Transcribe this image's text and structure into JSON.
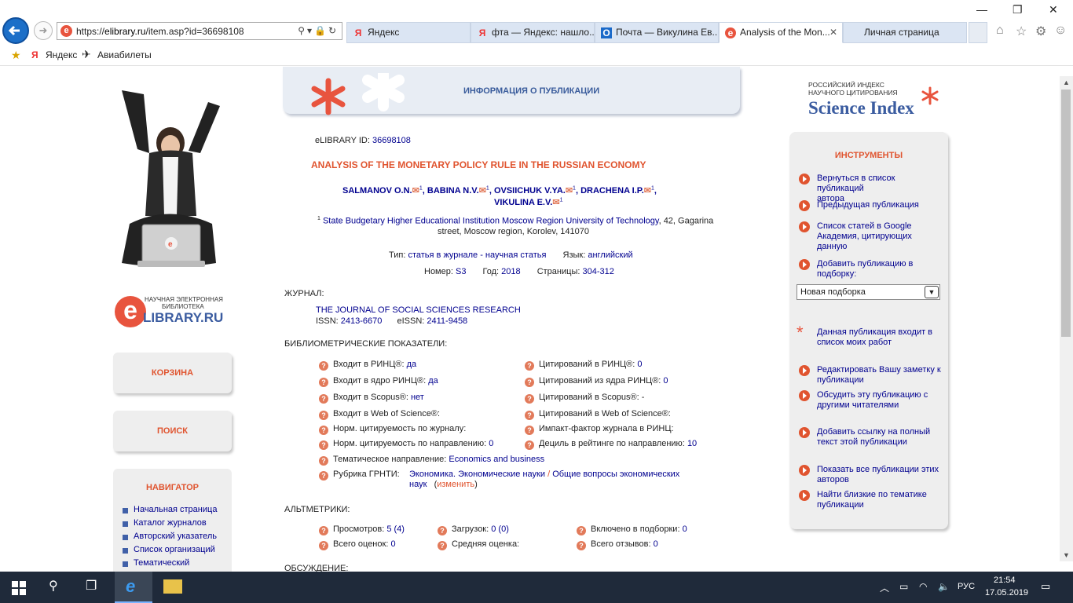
{
  "browser": {
    "url_prefix": "https://",
    "url_host": "elibrary.ru",
    "url_path": "/item.asp?id=36698108",
    "tabs": [
      {
        "icon": "Я",
        "label": "Яндекс"
      },
      {
        "icon": "Я",
        "label": "фта — Яндекс: нашло..."
      },
      {
        "icon": "О",
        "label": "Почта — Викулина Ев..."
      },
      {
        "icon": "e",
        "label": "Analysis of the Mon..."
      },
      {
        "icon": "",
        "label": "Личная страница"
      }
    ],
    "favorites": [
      {
        "label": "Яндекс"
      },
      {
        "label": "Авиабилеты"
      }
    ]
  },
  "left": {
    "logo_line1": "НАУЧНАЯ ЭЛЕКТРОННАЯ",
    "logo_line2": "БИБЛИОТЕКА",
    "logo_main": "LIBRARY.RU",
    "logo_e": "e",
    "cart": "КОРЗИНА",
    "search": "ПОИСК",
    "navigator": "НАВИГАТОР",
    "nav_items": [
      "Начальная страница",
      "Каталог журналов",
      "Авторский указатель",
      "Список организаций",
      "Тематический"
    ]
  },
  "header": {
    "title": "ИНФОРМАЦИЯ О ПУБЛИКАЦИИ"
  },
  "pub": {
    "id_label": "eLIBRARY ID:",
    "id": "36698108",
    "title": "ANALYSIS OF THE MONETARY POLICY RULE IN THE RUSSIAN ECONOMY",
    "authors_line1": [
      "SALMANOV O.N.",
      "BABINA N.V.",
      "OVSIICHUK V.YA.",
      "DRACHENA I.P."
    ],
    "authors_line2": "VIKULINA E.V.",
    "aff_num": "1",
    "affiliation_link": "State Budgetary Higher Educational Institution Moscow Region University of Technology",
    "affiliation_rest1": ", 42, Gagarina",
    "affiliation_rest2": "street, Moscow region, Korolev, 141070",
    "type_label": "Тип:",
    "type_value": "статья в журнале - научная статья",
    "lang_label": "Язык:",
    "lang_value": "английский",
    "num_label": "Номер:",
    "num_value": "S3",
    "year_label": "Год:",
    "year_value": "2018",
    "pages_label": "Страницы:",
    "pages_value": "304-312"
  },
  "journal": {
    "section": "ЖУРНАЛ:",
    "name": "THE JOURNAL OF SOCIAL SCIENCES RESEARCH",
    "issn_label": "ISSN:",
    "issn": "2413-6670",
    "eissn_label": "eISSN:",
    "eissn": "2411-9458"
  },
  "biblio": {
    "section": "БИБЛИОМЕТРИЧЕСКИЕ ПОКАЗАТЕЛИ:",
    "left": [
      {
        "label": "Входит в РИНЦ®:",
        "value": "да"
      },
      {
        "label": "Входит в ядро РИНЦ®:",
        "value": "да"
      },
      {
        "label": "Входит в Scopus®:",
        "value": "нет"
      },
      {
        "label": "Входит в Web of Science®:",
        "value": ""
      },
      {
        "label": "Норм. цитируемость по журналу:",
        "value": ""
      },
      {
        "label": "Норм. цитируемость по направлению:",
        "value": "0"
      }
    ],
    "right": [
      {
        "label": "Цитирований в РИНЦ®:",
        "value": "0"
      },
      {
        "label": "Цитирований из ядра РИНЦ®:",
        "value": "0"
      },
      {
        "label": "Цитирований в Scopus®:",
        "value": "-"
      },
      {
        "label": "Цитирований в Web of Science®:",
        "value": ""
      },
      {
        "label": "Импакт-фактор журнала в РИНЦ:",
        "value": ""
      },
      {
        "label": "Дециль в рейтинге по направлению:",
        "value": "10"
      }
    ],
    "topic_label": "Тематическое направление:",
    "topic_value": "Economics and business",
    "grnti_label": "Рубрика ГРНТИ:",
    "grnti_value1": "Экономика. Экономические науки",
    "grnti_sep": "/",
    "grnti_value2": "Общие вопросы экономических",
    "grnti_value3": "наук",
    "grnti_change_open": "(",
    "grnti_change": "изменить",
    "grnti_change_close": ")"
  },
  "alt": {
    "section": "АЛЬТМЕТРИКИ:",
    "views_label": "Просмотров:",
    "views": "5 (4)",
    "downloads_label": "Загрузок:",
    "downloads": "0 (0)",
    "incl_label": "Включено в подборки:",
    "incl": "0",
    "ratings_label": "Всего оценок:",
    "ratings": "0",
    "avg_label": "Средняя оценка:",
    "avg": "",
    "reviews_label": "Всего отзывов:",
    "reviews": "0",
    "discussion": "ОБСУЖДЕНИЕ:"
  },
  "right": {
    "si_line1": "РОССИЙСКИЙ ИНДЕКС",
    "si_line2": "НАУЧНОГО ЦИТИРОВАНИЯ",
    "si_main": "Science Index",
    "tools_title": "ИНСТРУМЕНТЫ",
    "tools": [
      [
        "Вернуться в список публикаций",
        "автора"
      ],
      [
        "Предыдущая публикация"
      ],
      [
        "Список статей в Google",
        "Академия, цитирующих данную"
      ],
      [
        "Добавить публикацию в",
        "подборку:"
      ],
      [
        "Данная публикация входит в",
        "список моих работ"
      ],
      [
        "Редактировать Вашу заметку к",
        "публикации"
      ],
      [
        "Обсудить эту публикацию с",
        "другими читателями"
      ],
      [
        "Добавить ссылку на полный",
        "текст этой публикации"
      ],
      [
        "Показать все публикации этих",
        "авторов"
      ],
      [
        "Найти близкие по тематике",
        "публикации"
      ]
    ],
    "select_value": "Новая подборка"
  },
  "taskbar": {
    "lang": "РУС",
    "time": "21:54",
    "date": "17.05.2019"
  },
  "colors": {
    "accent": "#e0542f",
    "link": "#00008f",
    "header_text": "#3a5c9c"
  }
}
